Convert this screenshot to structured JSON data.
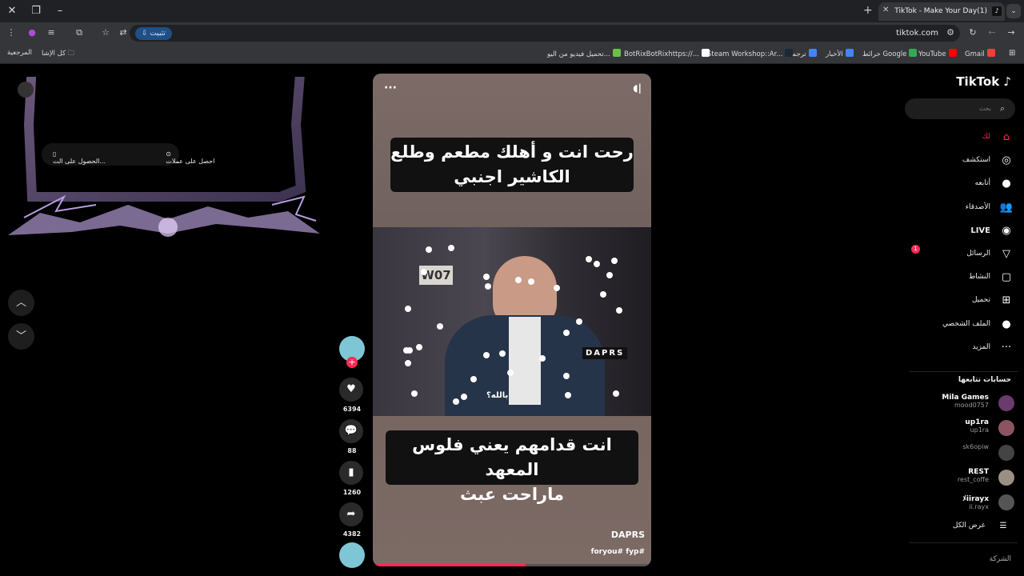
{
  "browser": {
    "tab_title": "(1)TikTok - Make Your Day",
    "tab_logo": "♪",
    "url": "tiktok.com",
    "install_label": "تثبيت",
    "bookmarks": [
      {
        "label": "Gmail",
        "color": "#ea4335"
      },
      {
        "label": "YouTube",
        "color": "#ff0000"
      },
      {
        "label": "خرائط Google",
        "color": "#34a853"
      },
      {
        "label": "الأخبار",
        "color": "#4285f4"
      },
      {
        "label": "ترجمة",
        "color": "#4285f4"
      },
      {
        "label": "Steam Workshop::Ar...",
        "color": "#1b2838"
      },
      {
        "label": "BotRixBotRixhttps://...",
        "color": "#ffffff"
      },
      {
        "label": "تحميل فيديو من اليو...",
        "color": "#6cc04a"
      }
    ],
    "bookmarks_all": "كل الإشا",
    "bookmarks_ref": "المرجعية"
  },
  "promo": {
    "get_coins": "احصل على عملات",
    "get_app": "الحصول على الت..."
  },
  "video": {
    "top_caption": "رحت انت و أهلك مطعم وطلع\nالكاشير اجنبي",
    "bottom_caption": "انت قدامهم يعني فلوس المعهد\nماراحت عبث",
    "subtitle": "بالله؟",
    "watermark": "DAPRS",
    "author": "DAPRS",
    "hashtags": "foryou# fyp#",
    "progress_percent": 55
  },
  "actions": {
    "likes": "6394",
    "comments": "88",
    "saves": "1260",
    "shares": "4382"
  },
  "sidebar": {
    "logo": "TikTok",
    "search_placeholder": "بحث",
    "nav": [
      {
        "label": "لك",
        "icon": "home-icon",
        "glyph": "⌂"
      },
      {
        "label": "استكشف",
        "icon": "compass-icon",
        "glyph": "◎"
      },
      {
        "label": "أتابعه",
        "icon": "following-avatar-icon",
        "glyph": "●"
      },
      {
        "label": "الأصدقاء",
        "icon": "friends-icon",
        "glyph": "👥"
      },
      {
        "label": "LIVE",
        "icon": "live-icon",
        "glyph": "◉"
      },
      {
        "label": "الرسائل",
        "icon": "send-icon",
        "glyph": "▽"
      },
      {
        "label": "النشاط",
        "icon": "activity-icon",
        "glyph": "▢"
      },
      {
        "label": "تحميل",
        "icon": "upload-icon",
        "glyph": "⊞"
      },
      {
        "label": "الملف الشخصي",
        "icon": "profile-icon",
        "glyph": "●"
      },
      {
        "label": "المزيد",
        "icon": "more-icon",
        "glyph": "···"
      }
    ],
    "messages_badge": "1",
    "following_heading": "حسابات تتابعها",
    "accounts": [
      {
        "name": "Mila Games",
        "handle": "mood0757",
        "color": "#6b3a6e"
      },
      {
        "name": "up1ra",
        "handle": "up1ra",
        "color": "#8a5560"
      },
      {
        "name": "",
        "handle": "sk6opiw",
        "color": "#444"
      },
      {
        "name": "REST",
        "handle": "rest_coffe",
        "color": "#9a8f83"
      },
      {
        "name": "ﾒiirayx",
        "handle": "ii.rayx",
        "color": "#555"
      }
    ],
    "see_all": "عرض الكل",
    "company": "الشركة"
  },
  "colors": {
    "accent": "#fe2c55",
    "chrome_dark": "#202124",
    "chrome_mid": "#35363a"
  }
}
